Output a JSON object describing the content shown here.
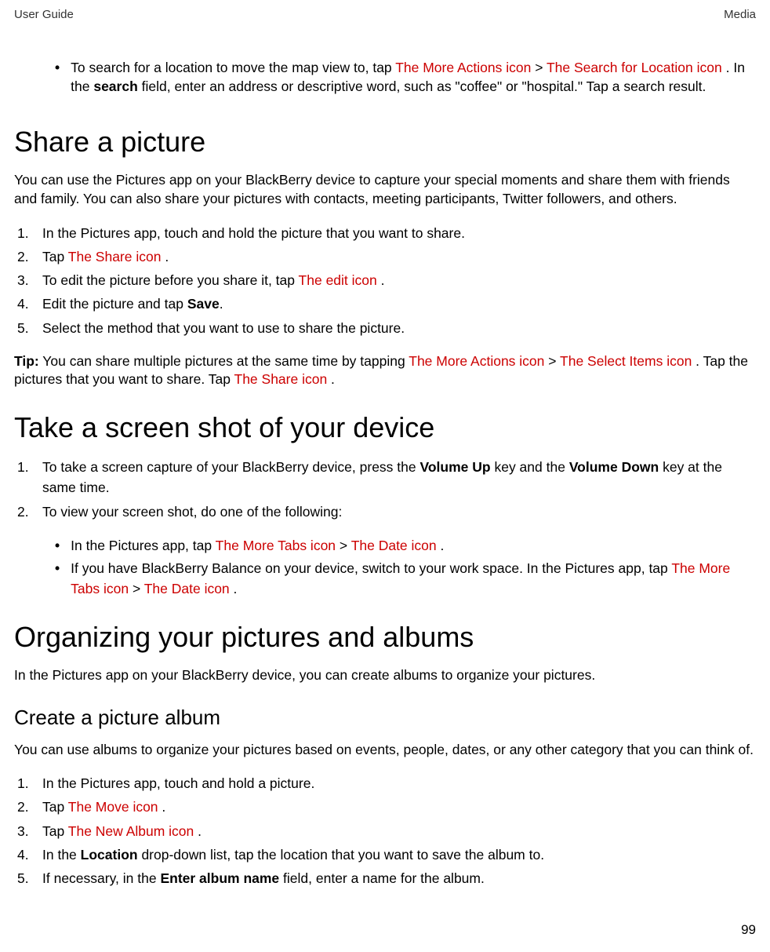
{
  "header": {
    "left": "User Guide",
    "right": "Media"
  },
  "intro": {
    "text1": "To search for a location to move the map view to, tap ",
    "link1": "The More Actions icon",
    "sep1": " > ",
    "link2": "The Search for Location icon",
    "text2": " . In the ",
    "bold1": "search",
    "text3": " field, enter an address or descriptive word, such as \"coffee\" or \"hospital.\" Tap a search result."
  },
  "share": {
    "title": "Share a picture",
    "para": "You can use the Pictures app on your BlackBerry device to capture your special moments and share them with friends and family. You can also share your pictures with contacts, meeting participants, Twitter followers, and others.",
    "steps": {
      "s1": "In the Pictures app, touch and hold the picture that you want to share.",
      "s2a": "Tap ",
      "s2b": "The Share icon",
      "s2c": " .",
      "s3a": "To edit the picture before you share it, tap ",
      "s3b": "The edit icon",
      "s3c": " .",
      "s4a": "Edit the picture and tap ",
      "s4b": "Save",
      "s4c": ".",
      "s5": "Select the method that you want to use to share the picture."
    },
    "tip": {
      "label": "Tip:",
      "t1": " You can share multiple pictures at the same time by tapping ",
      "link1": "The More Actions icon",
      "sep": " > ",
      "link2": "The Select Items icon",
      "t2": " . Tap the pictures that you want to share. Tap ",
      "link3": "The Share icon",
      "t3": " ."
    }
  },
  "screenshot": {
    "title": "Take a screen shot of your device",
    "steps": {
      "s1a": "To take a screen capture of your BlackBerry device, press the ",
      "s1b": "Volume Up",
      "s1c": " key and the ",
      "s1d": "Volume Down",
      "s1e": " key at the same time.",
      "s2": "To view your screen shot, do one of the following:"
    },
    "bullets": {
      "b1a": "In the Pictures app, tap ",
      "b1b": "The More Tabs icon",
      "b1sep": " > ",
      "b1c": "The Date icon",
      "b1d": " .",
      "b2a": "If you have BlackBerry Balance on your device, switch to your work space. In the Pictures app, tap ",
      "b2b": "The More Tabs icon",
      "b2sep": " > ",
      "b2c": "The Date icon",
      "b2d": " ."
    }
  },
  "organize": {
    "title": "Organizing your pictures and albums",
    "para": "In the Pictures app on your BlackBerry device, you can create albums to organize your pictures."
  },
  "createAlbum": {
    "title": "Create a picture album",
    "para": "You can use albums to organize your pictures based on events, people, dates, or any other category that you can think of.",
    "steps": {
      "s1": "In the Pictures app, touch and hold a picture.",
      "s2a": "Tap ",
      "s2b": "The Move icon",
      "s2c": " .",
      "s3a": "Tap ",
      "s3b": "The New Album icon",
      "s3c": " .",
      "s4a": "In the ",
      "s4b": "Location",
      "s4c": " drop-down list, tap the location that you want to save the album to.",
      "s5a": "If necessary, in the ",
      "s5b": "Enter album name",
      "s5c": " field, enter a name for the album."
    }
  },
  "pageNumber": "99"
}
